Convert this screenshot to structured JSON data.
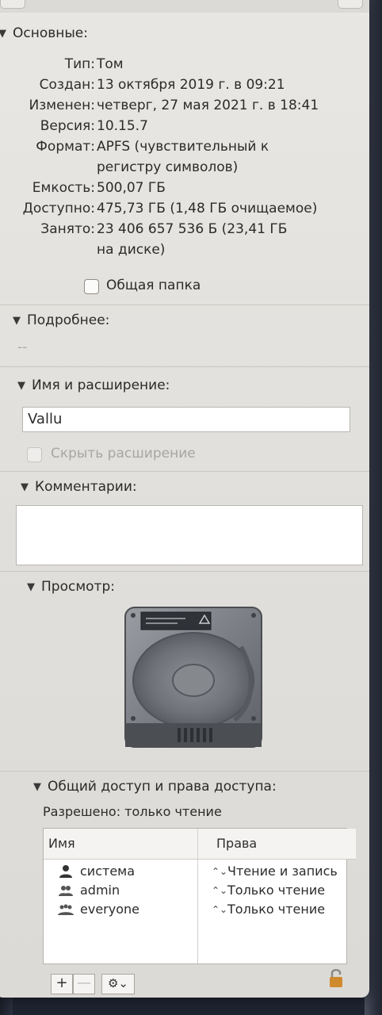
{
  "general": {
    "title": "Основные:",
    "fields": [
      {
        "key": "Тип:",
        "value": "Том"
      },
      {
        "key": "Создан:",
        "value": "13 октября 2019 г. в 09:21"
      },
      {
        "key": "Изменен:",
        "value": "четверг, 27 мая 2021 г. в 18:41"
      },
      {
        "key": "Версия:",
        "value": "10.15.7"
      },
      {
        "key": "Формат:",
        "value": "APFS (чувствительный к",
        "value2": "регистру символов)"
      },
      {
        "key": "Емкость:",
        "value": "500,07 ГБ"
      },
      {
        "key": "Доступно:",
        "value": "475,73 ГБ (1,48 ГБ очищаемое)"
      },
      {
        "key": "Занято:",
        "value": "23 406 657 536 Б (23,41 ГБ",
        "value2": "на диске)"
      }
    ],
    "shared_folder_label": "Общая папка"
  },
  "more_info": {
    "title": "Подробнее:",
    "value": "--"
  },
  "name_ext": {
    "title": "Имя и расширение:",
    "name_value": "Vallu",
    "hide_ext_label": "Скрыть расширение"
  },
  "comments": {
    "title": "Комментарии:",
    "text": ""
  },
  "preview": {
    "title": "Просмотр:",
    "icon": "hard-drive-icon"
  },
  "sharing": {
    "title": "Общий доступ и права доступа:",
    "summary": "Разрешено: только чтение",
    "columns": [
      "Имя",
      "Права"
    ],
    "rows": [
      {
        "name": "система",
        "perm": "Чтение и запись",
        "icon": "user-icon"
      },
      {
        "name": "admin",
        "perm": "Только чтение",
        "icon": "group-icon"
      },
      {
        "name": "everyone",
        "perm": "Только чтение",
        "icon": "group-icon"
      }
    ],
    "add_label": "+",
    "remove_label": "—",
    "action_label": "⚙︎⌄",
    "lock_icon": "lock-icon"
  }
}
